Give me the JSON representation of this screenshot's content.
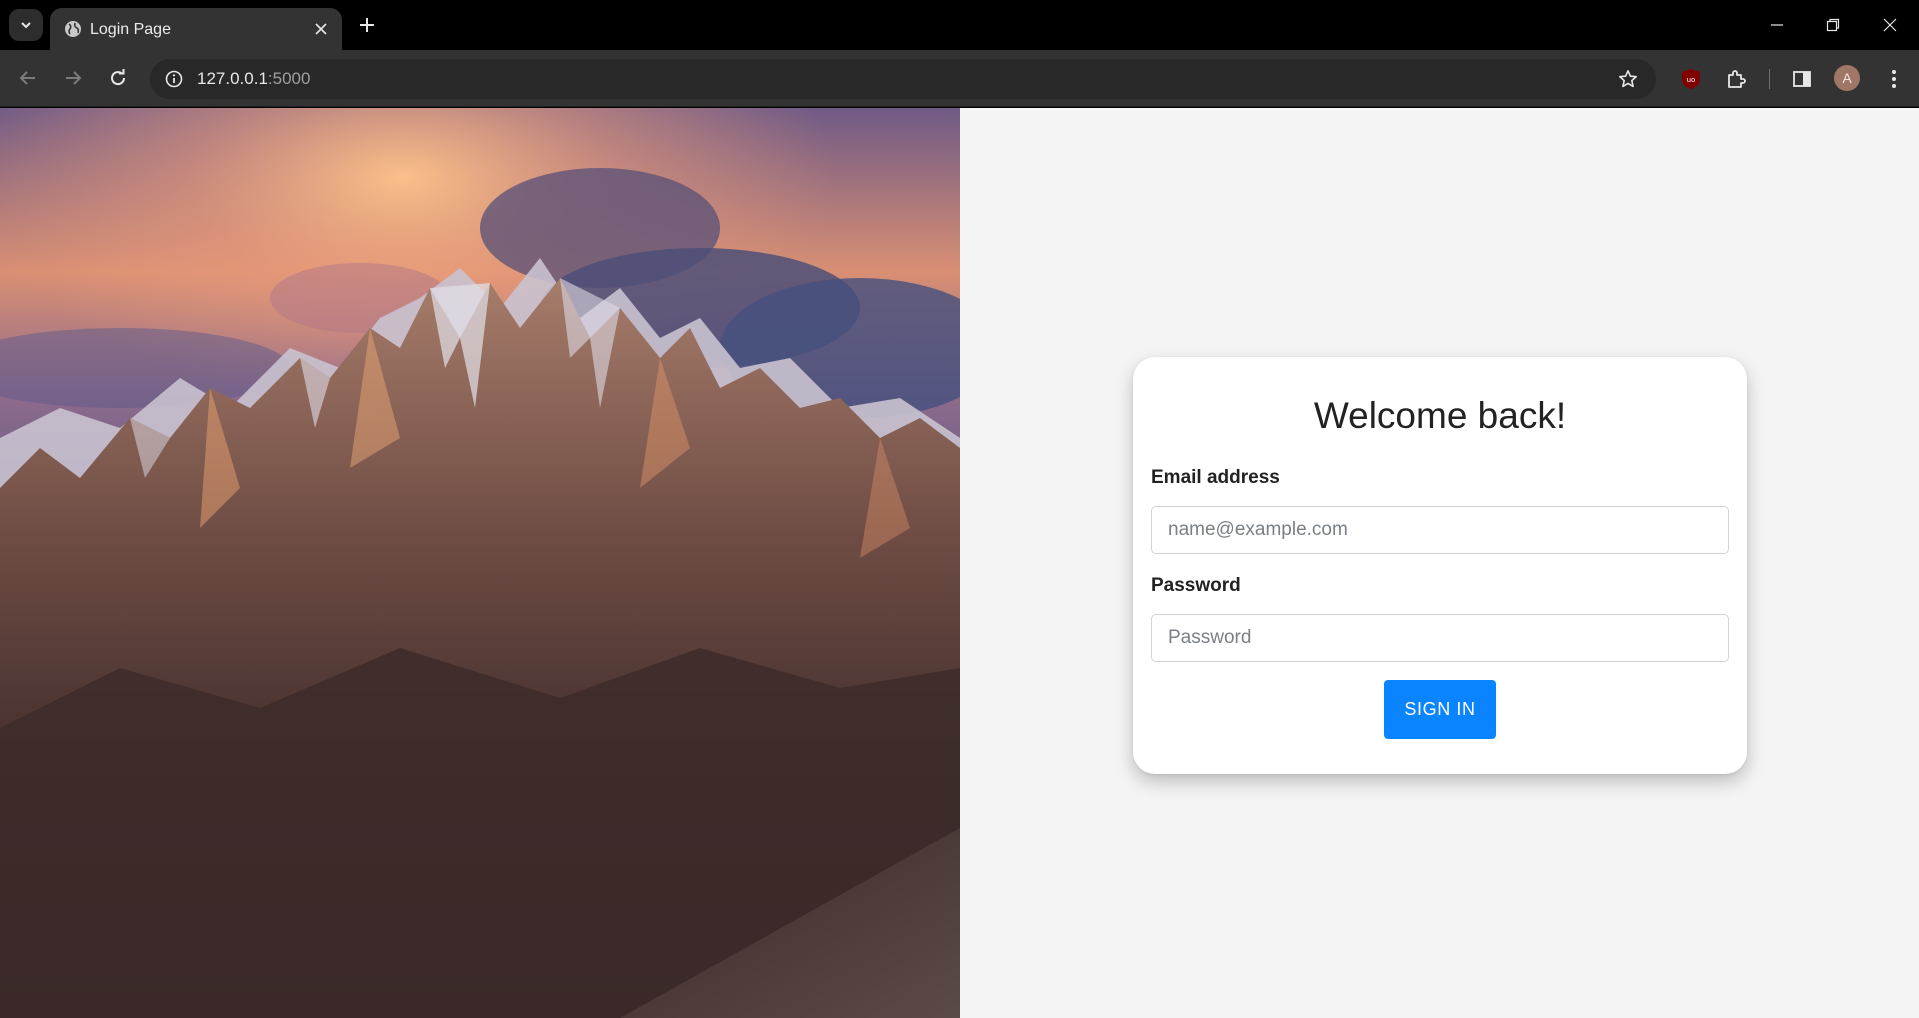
{
  "browser": {
    "tab_title": "Login Page",
    "url_host": "127.0.0.1",
    "url_port": ":5000",
    "avatar_initial": "A",
    "icons": [
      "tab-search-icon",
      "globe-icon",
      "close-icon",
      "plus-icon",
      "minimize-icon",
      "restore-icon",
      "back-icon",
      "forward-icon",
      "reload-icon",
      "info-icon",
      "star-icon",
      "ublock-icon",
      "extensions-icon",
      "side-panel-icon",
      "kebab-menu-icon"
    ]
  },
  "login": {
    "title": "Welcome back!",
    "email_label": "Email address",
    "email_placeholder": "name@example.com",
    "email_value": "",
    "password_label": "Password",
    "password_placeholder": "Password",
    "password_value": "",
    "submit_label": "SIGN IN"
  },
  "colors": {
    "accent": "#0a84ff",
    "page_background": "#f4f4f4",
    "card_background": "#ffffff"
  }
}
